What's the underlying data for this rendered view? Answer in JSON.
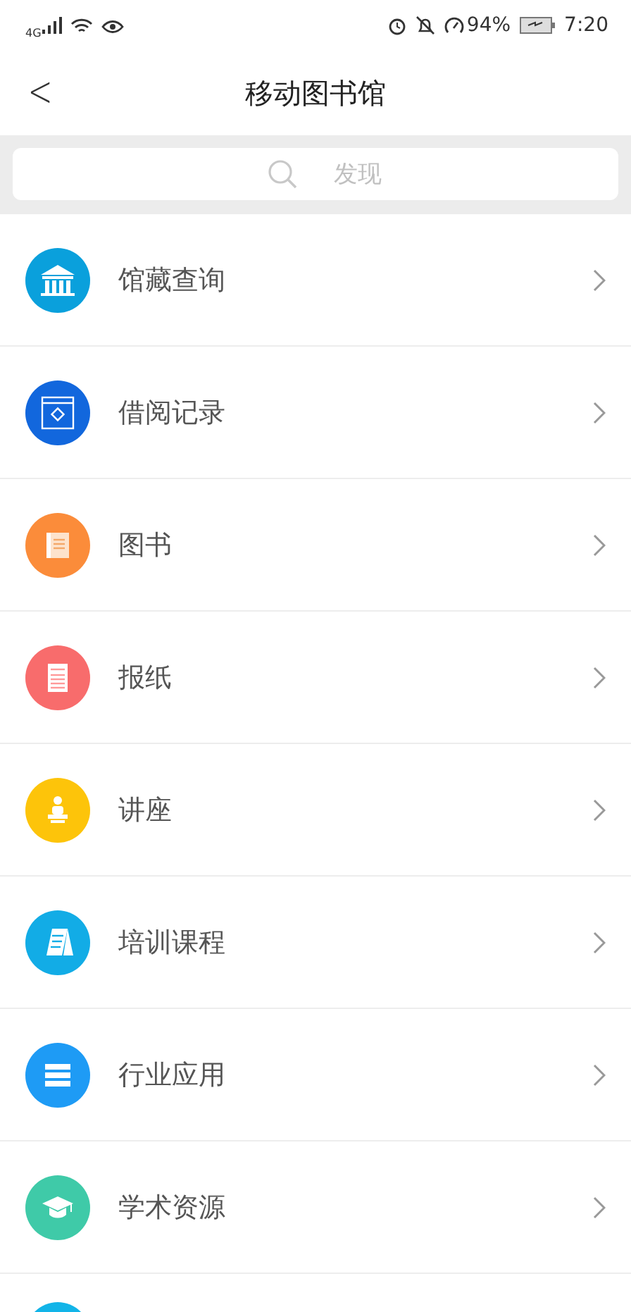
{
  "status_bar": {
    "network": "4G",
    "battery": "94%",
    "time": "7:20"
  },
  "header": {
    "back": "<",
    "title": "移动图书馆"
  },
  "search": {
    "placeholder": "发现"
  },
  "items": [
    {
      "label": "馆藏查询",
      "kind": "museum",
      "color": "#0aa0dc"
    },
    {
      "label": "借阅记录",
      "kind": "window",
      "color": "#1267dd"
    },
    {
      "label": "图书",
      "kind": "book",
      "color": "#fb8c3a"
    },
    {
      "label": "报纸",
      "kind": "newspaper",
      "color": "#f86c6c"
    },
    {
      "label": "讲座",
      "kind": "lecture",
      "color": "#fdc40a"
    },
    {
      "label": "培训课程",
      "kind": "board",
      "color": "#12ace6"
    },
    {
      "label": "行业应用",
      "kind": "server",
      "color": "#1e9bf5"
    },
    {
      "label": "学术资源",
      "kind": "cap",
      "color": "#3fcaa8"
    }
  ],
  "partial_item": {
    "color": "#12b4e8"
  }
}
